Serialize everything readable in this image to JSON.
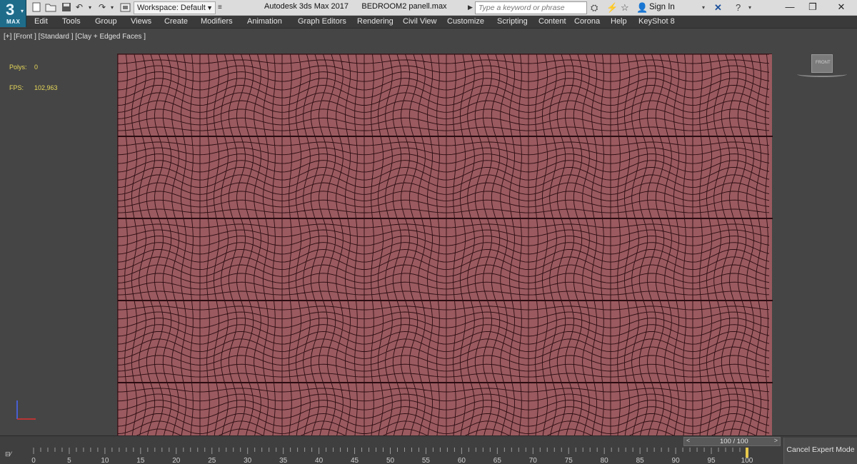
{
  "app": {
    "logo_main": "3",
    "logo_sub": "MAX",
    "window_title": "Autodesk 3ds Max 2017      BEDROOM2 panell.max"
  },
  "quick_access": {
    "workspace_value": "Workspace: Default",
    "search_placeholder": "Type a keyword or phrase",
    "sign_in": "Sign In"
  },
  "menu": {
    "items": [
      "Edit",
      "Tools",
      "Group",
      "Views",
      "Create",
      "Modifiers",
      "Animation",
      "Graph Editors",
      "Rendering",
      "Civil View",
      "Customize",
      "Scripting",
      "Content",
      "Corona",
      "Help",
      "KeyShot 8"
    ]
  },
  "viewport": {
    "label": "[+] [Front ] [Standard ] [Clay + Edged Faces ]",
    "polys_label": "Polys:",
    "polys_value": "0",
    "fps_label": "FPS:",
    "fps_value": "102,963",
    "viewcube_label": "FRONT",
    "panel_color": "#9a5a5f",
    "wire_color": "#2b0d12"
  },
  "timeline": {
    "frame_display": "100 / 100",
    "cancel_expert": "Cancel Expert Mode",
    "ticks": [
      "0",
      "5",
      "10",
      "15",
      "20",
      "25",
      "30",
      "35",
      "40",
      "45",
      "50",
      "55",
      "60",
      "65",
      "70",
      "75",
      "80",
      "85",
      "90",
      "95",
      "100"
    ]
  }
}
